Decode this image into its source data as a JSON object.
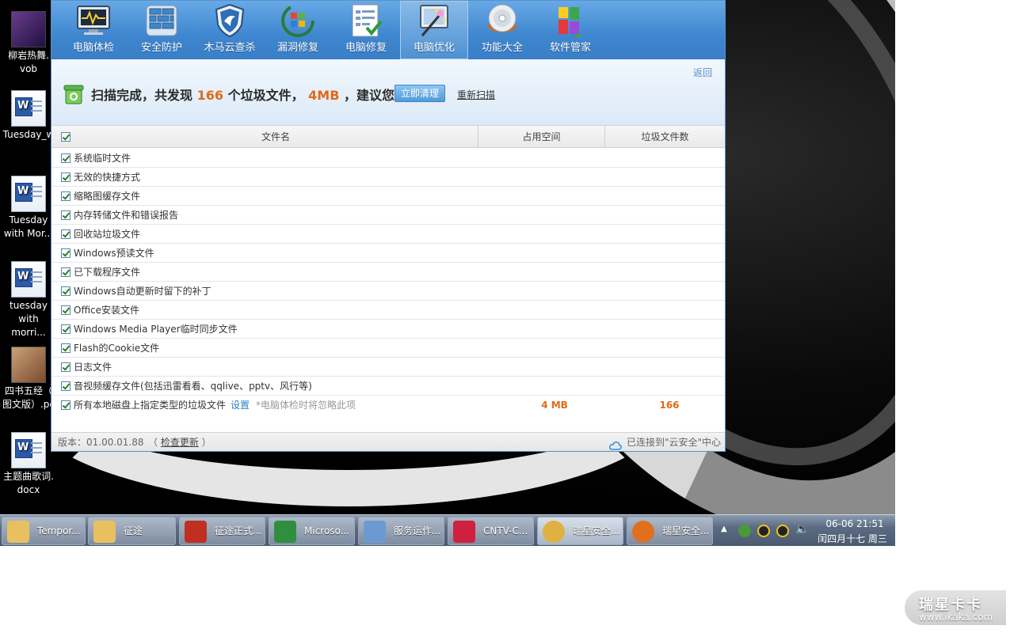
{
  "desktop": {
    "icons": [
      {
        "label_line1": "柳岩热舞.",
        "label_line2": "vob"
      },
      {
        "label_line1": "Tuesday_w",
        "label_line2": ""
      },
      {
        "label_line1": "Tuesday",
        "label_line2": "with Mor..."
      },
      {
        "label_line1": "tuesday",
        "label_line2": "with morri..."
      },
      {
        "label_line1": "四书五经（",
        "label_line2": "图文版）.pc"
      },
      {
        "label_line1": "主题曲歌词.",
        "label_line2": "docx"
      }
    ]
  },
  "toolbar": {
    "items": [
      {
        "label": "电脑体检",
        "icon": "monitor-pulse-icon"
      },
      {
        "label": "安全防护",
        "icon": "firewall-icon"
      },
      {
        "label": "木马云查杀",
        "icon": "shield-icon"
      },
      {
        "label": "漏洞修复",
        "icon": "windows-update-icon"
      },
      {
        "label": "电脑修复",
        "icon": "checklist-icon"
      },
      {
        "label": "电脑优化",
        "icon": "magic-wand-icon"
      },
      {
        "label": "功能大全",
        "icon": "disc-icon"
      },
      {
        "label": "软件管家",
        "icon": "software-blocks-icon"
      }
    ],
    "active": "电脑优化"
  },
  "result": {
    "back": "返回",
    "prefix": "扫描完成，共发现",
    "count": "166",
    "mid": "个垃圾文件，",
    "size": "4MB",
    "suffix": "，建议您",
    "clean_button": "立即清理",
    "rescan": "重新扫描"
  },
  "table": {
    "headers": {
      "name": "文件名",
      "space": "占用空间",
      "count": "垃圾文件数"
    },
    "rows": [
      {
        "name": "系统临时文件"
      },
      {
        "name": "无效的快捷方式"
      },
      {
        "name": "缩略图缓存文件"
      },
      {
        "name": "内存转储文件和错误报告"
      },
      {
        "name": "回收站垃圾文件"
      },
      {
        "name": "Windows预读文件"
      },
      {
        "name": "已下载程序文件"
      },
      {
        "name": "Windows自动更新时留下的补丁"
      },
      {
        "name": "Office安装文件"
      },
      {
        "name": "Windows Media Player临时同步文件"
      },
      {
        "name": "Flash的Cookie文件"
      },
      {
        "name": "日志文件"
      },
      {
        "name": "音视频缓存文件(包括迅雷看看、qqlive、pptv、风行等)"
      },
      {
        "name": "所有本地磁盘上指定类型的垃圾文件",
        "link": "设置",
        "note": "*电脑体检时将忽略此项",
        "size": "4 MB",
        "count": "166"
      }
    ]
  },
  "status": {
    "version": "版本：01.00.01.88",
    "check_update": "检查更新",
    "cloud": "已连接到\"云安全\"中心"
  },
  "taskbar": {
    "buttons": [
      {
        "label": "Tempor...",
        "color": "#e8c060"
      },
      {
        "label": "征途",
        "color": "#e8c060"
      },
      {
        "label": "征途正式...",
        "color": "#c03020"
      },
      {
        "label": "Microso...",
        "color": "#2f8f3f"
      },
      {
        "label": "服务运作...",
        "color": "#6a9ad0"
      },
      {
        "label": "CNTV-C...",
        "color": "#d02040"
      },
      {
        "label": "瑞星安全...",
        "color": "#e0b040"
      },
      {
        "label": "瑞星安全...",
        "color": "#e07020"
      }
    ],
    "clock_time": "06-06  21:51",
    "clock_date": "闰四月十七 周三"
  },
  "watermark": {
    "title": "瑞星卡卡",
    "url": "www.ikaka.com"
  }
}
